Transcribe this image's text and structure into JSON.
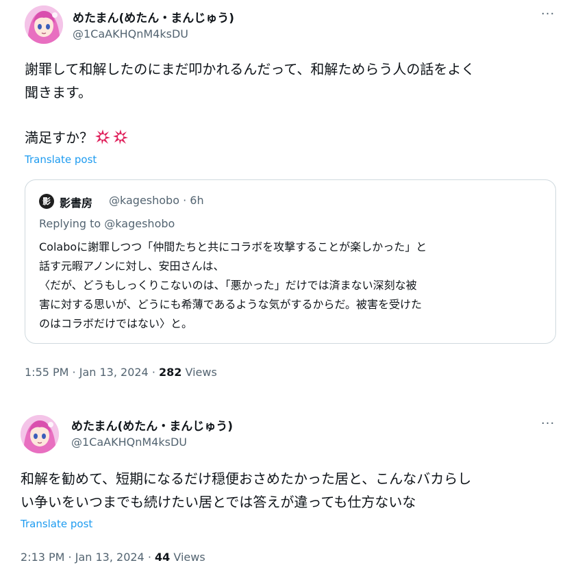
{
  "tweet1": {
    "display_name": "めたまん(めたん・まんじゅう)",
    "handle": "@1CaAKHQnM4ksDU",
    "more": "···",
    "lines": [
      "謝罪して和解したのにまだ叩かれるんだって、和解ためらう人の話をよく",
      "聞きます。",
      "満足すか？"
    ],
    "emoji": [
      "anger-symbol-icon",
      "anger-symbol-icon"
    ],
    "translate": "Translate post",
    "timestamp": "1:55 PM · Jan 13, 2024 ·",
    "views_count": "282",
    "views_label": "Views",
    "quote": {
      "display_name": "影書房",
      "handle": "@kageshobo · 6h",
      "avatar_char": "影",
      "replying_prefix": "Replying to",
      "replying_handle": "@kageshobo",
      "lines": [
        "Colaboに謝罪しつつ「仲間たちと共にコラボを攻撃することが楽しかった」と",
        "話す元暇アノンに対し、安田さんは、",
        "〈だが、どうもしっくりこないのは、「悪かった」だけでは済まない深刻な被",
        "害に対する思いが、どうにも希薄であるような気がするからだ。被害を受けた",
        "のはコラボだけではない〉と。"
      ]
    }
  },
  "tweet2": {
    "display_name": "めたまん(めたん・まんじゅう)",
    "handle": "@1CaAKHQnM4ksDU",
    "more": "···",
    "lines": [
      "和解を勧めて、短期になるだけ穏便おさめたかった居と、こんなバカらし",
      "い争いをいつまでも続けたい居とでは答えが違っても仕方ないな"
    ],
    "translate": "Translate post",
    "timestamp": "2:13 PM · Jan 13, 2024 ·",
    "views_count": "44",
    "views_label": "Views"
  },
  "colors": {
    "accent": "#1d9bf0",
    "muted": "#536471",
    "anger": "#e0245e"
  }
}
